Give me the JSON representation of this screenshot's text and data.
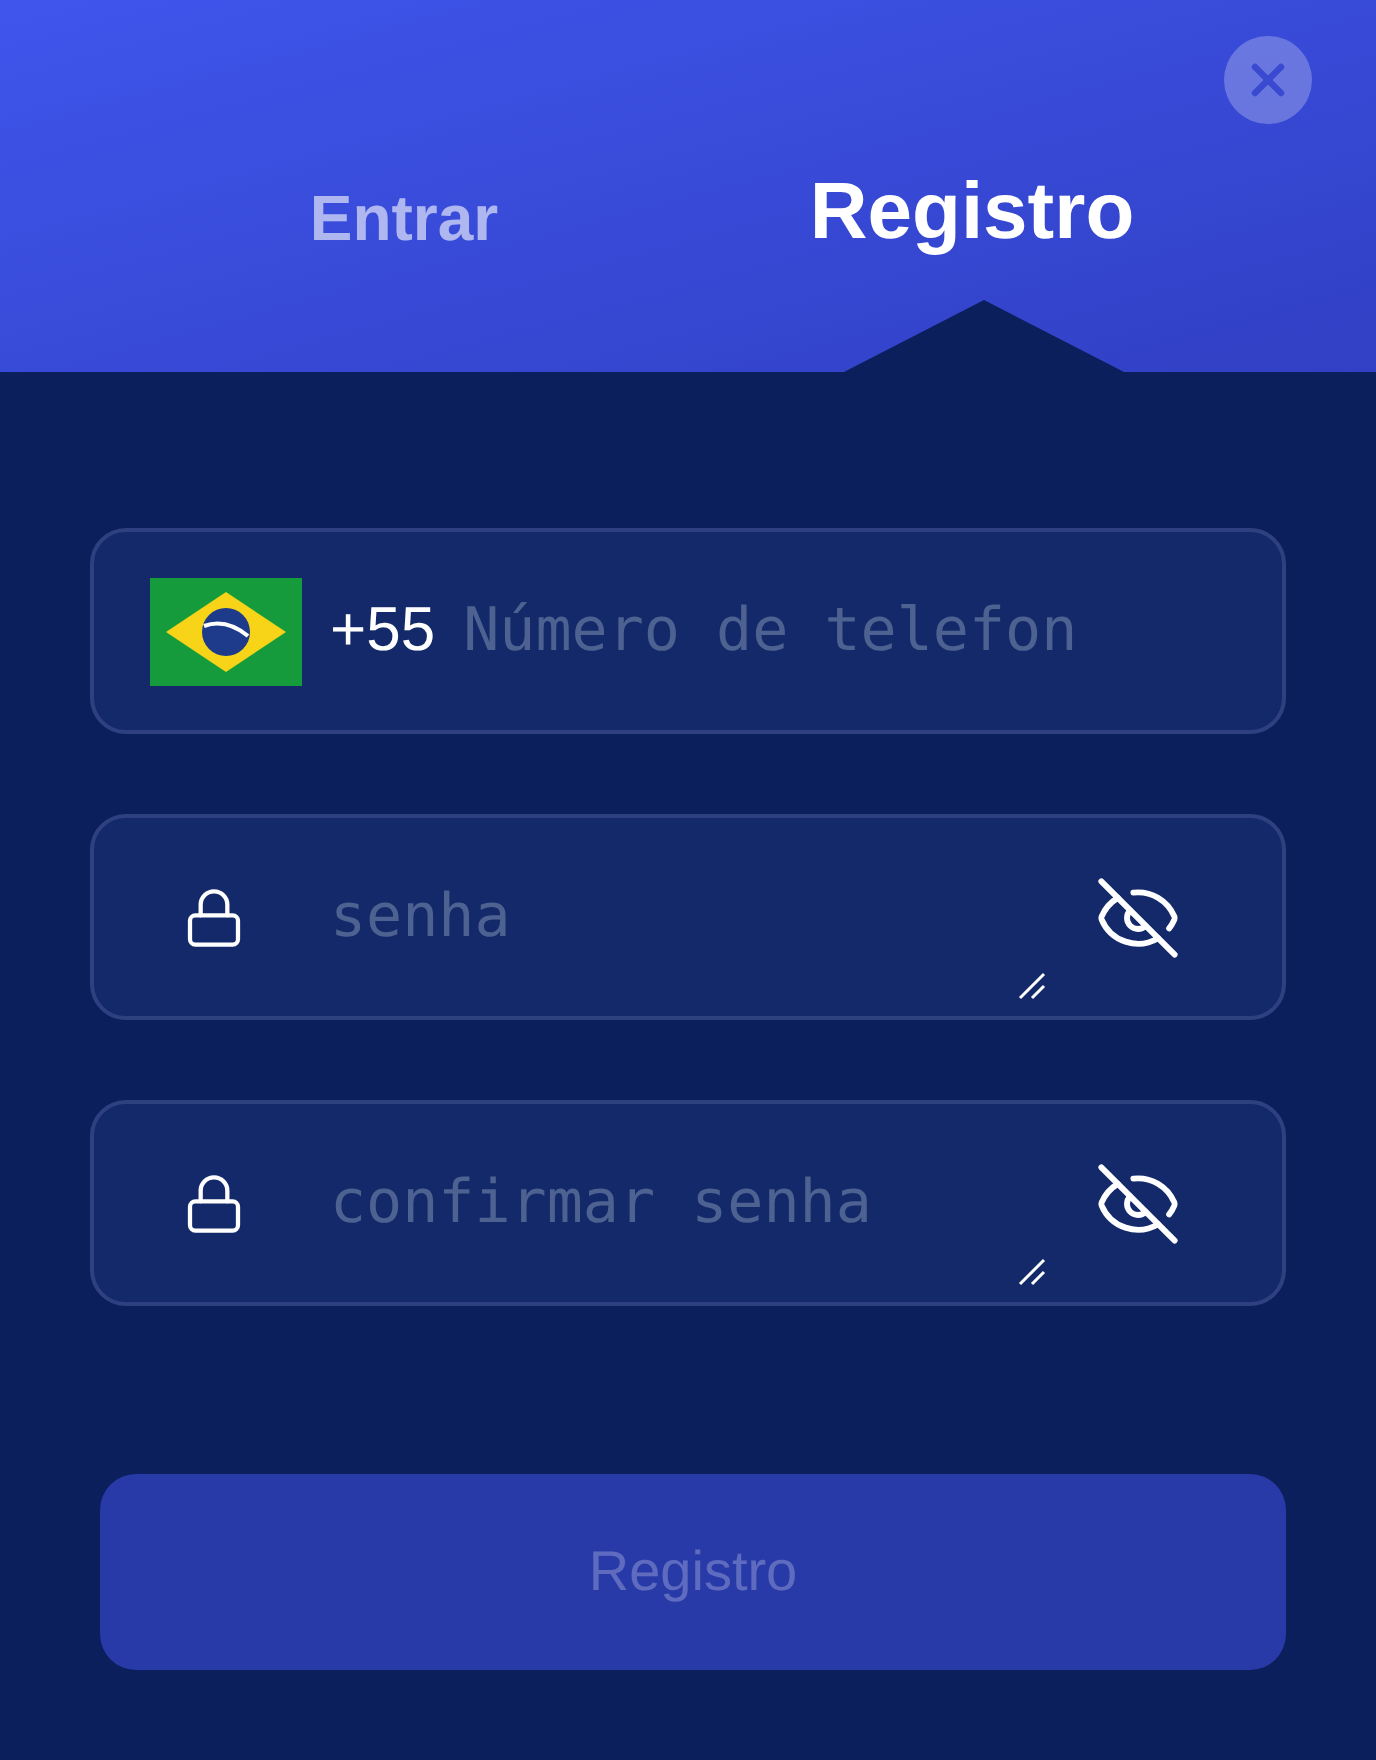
{
  "tabs": [
    {
      "label": "Entrar",
      "selected": false
    },
    {
      "label": "Registro",
      "selected": true
    }
  ],
  "phone": {
    "country_code": "+55",
    "placeholder": "Número de telefon"
  },
  "password_fields": [
    {
      "placeholder": "senha",
      "visible": false
    },
    {
      "placeholder": "confirmar senha",
      "visible": false
    }
  ],
  "submit": {
    "label": "Registro",
    "disabled": true
  }
}
